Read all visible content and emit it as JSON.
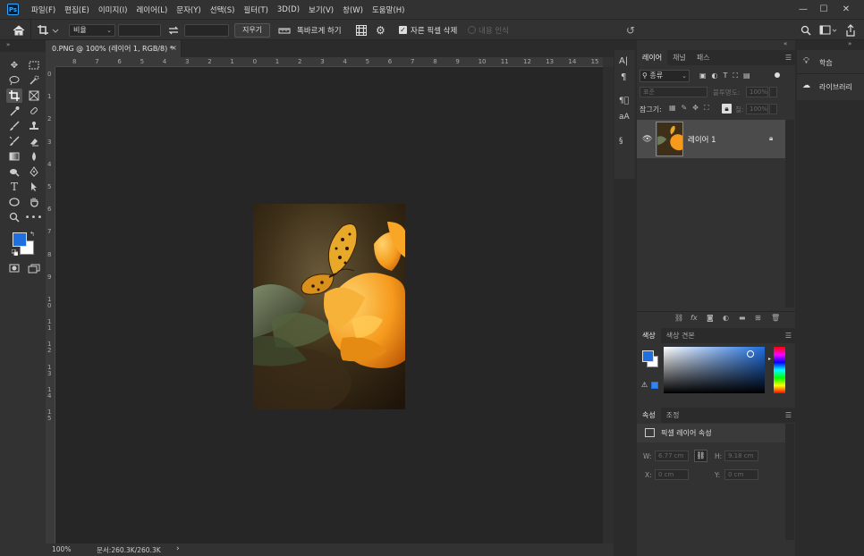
{
  "app": {
    "logo": "Ps"
  },
  "menu": [
    "파일(F)",
    "편집(E)",
    "이미지(I)",
    "레이어(L)",
    "문자(Y)",
    "선택(S)",
    "필터(T)",
    "3D(D)",
    "보기(V)",
    "창(W)",
    "도움말(H)"
  ],
  "window_controls": {
    "minimize": "—",
    "maximize": "☐",
    "close": "✕"
  },
  "options": {
    "ratio_value": "비율",
    "clear_label": "지우기",
    "straighten_label": "똑바르게 하기",
    "delete_cropped_label": "자른 픽셀 삭제",
    "delete_cropped_checked": true,
    "content_aware_label": "내용 인식"
  },
  "document": {
    "tab_title": "0.PNG @ 100% (레이어 1, RGB/8) *",
    "zoom": "100%",
    "doc_size": "문서:260.3K/260.3K",
    "ruler_h_labels": [
      "8",
      "7",
      "6",
      "5",
      "4",
      "3",
      "2",
      "1",
      "0",
      "1",
      "2",
      "3",
      "4",
      "5",
      "6",
      "7",
      "8",
      "9",
      "10",
      "11",
      "12",
      "13",
      "14",
      "15"
    ],
    "ruler_v_labels": [
      "0",
      "1",
      "2",
      "3",
      "4",
      "5",
      "6",
      "7",
      "8",
      "9",
      "1 0",
      "1 1",
      "1 2",
      "1 3",
      "1 4",
      "1 5"
    ]
  },
  "layers_panel": {
    "tabs": [
      "레이어",
      "채널",
      "패스"
    ],
    "filter_label": "종류",
    "blend_mode": "표준",
    "opacity_label": "불투명도:",
    "opacity_value": "100%",
    "lock_label": "잠그기:",
    "fill_label": "칠:",
    "fill_value": "100%",
    "layer_name": "레이어 1"
  },
  "color_panel": {
    "tabs": [
      "색상",
      "색상 견본"
    ],
    "foreground": "#1f6fe0",
    "background": "#ffffff"
  },
  "properties_panel": {
    "tabs": [
      "속성",
      "조정"
    ],
    "title": "픽셀 레이어 속성",
    "w_label": "W:",
    "w_value": "6.77 cm",
    "h_label": "H:",
    "h_value": "9.18 cm",
    "x_label": "X:",
    "x_value": "0 cm",
    "y_label": "Y:",
    "y_value": "0 cm"
  },
  "learn_panel": {
    "learn_label": "학습",
    "libraries_label": "라이브러리"
  }
}
